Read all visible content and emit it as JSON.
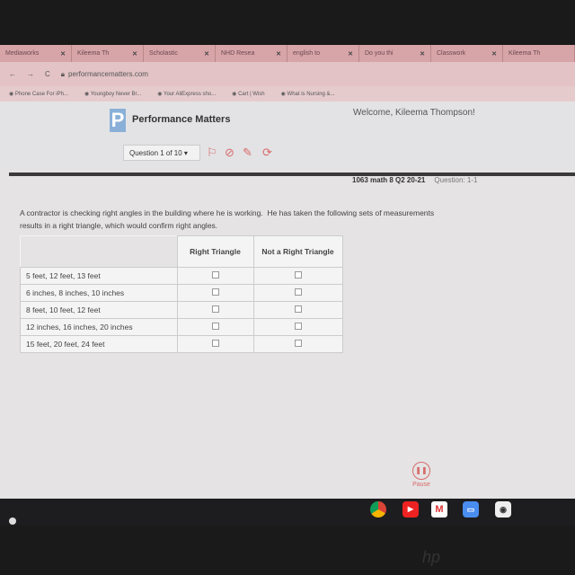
{
  "browser": {
    "tabs": [
      {
        "label": "Mediaworks"
      },
      {
        "label": "Kileema Th"
      },
      {
        "label": "Scholastic"
      },
      {
        "label": "NHD Resea"
      },
      {
        "label": "english to"
      },
      {
        "label": "Do you thi"
      },
      {
        "label": "Classwork"
      },
      {
        "label": "Kileema Th"
      }
    ],
    "url": "performancematters.com",
    "bookmarks": [
      {
        "label": "Phone Case For iPh..."
      },
      {
        "label": "Youngboy Never Br..."
      },
      {
        "label": "Your AliExpress sho..."
      },
      {
        "label": "Cart | Wish"
      },
      {
        "label": "What is Nursing &..."
      }
    ]
  },
  "header": {
    "logo": "P",
    "title": "Performance Matters",
    "welcome": "Welcome, Kileema Thompson!",
    "question_select": "Question 1 of 10 ▾"
  },
  "test": {
    "name": "1063 math 8 Q2 20-21",
    "question_label": "Question: 1-1"
  },
  "question": {
    "text": "A contractor is checking right angles in the building where he is working.  He has taken the following sets of measurements\nresults in a right triangle, which would confirm right angles.",
    "columns": [
      "Right Triangle",
      "Not a Right Triangle"
    ],
    "rows": [
      {
        "label": "5 feet, 12 feet, 13 feet"
      },
      {
        "label": "6 inches, 8 inches, 10 inches"
      },
      {
        "label": "8 feet, 10 feet, 12 feet"
      },
      {
        "label": "12 inches, 16 inches, 20 inches"
      },
      {
        "label": "15 feet, 20 feet, 24 feet"
      }
    ]
  },
  "footer": {
    "pause": "Pause"
  },
  "colors": {
    "accent": "#d86a6a",
    "logo": "#8ab0d8"
  }
}
